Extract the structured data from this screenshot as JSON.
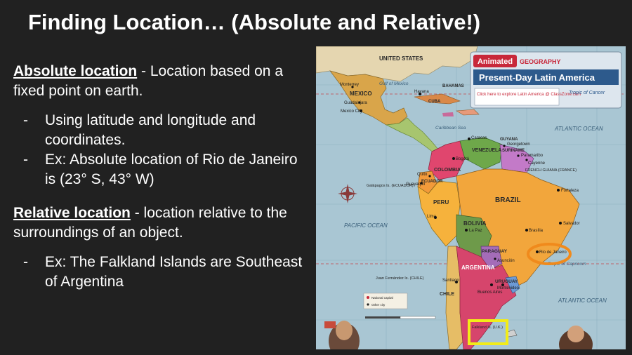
{
  "slide": {
    "title": "Finding Location… (Absolute and Relative!)"
  },
  "absolute": {
    "term": "Absolute location",
    "definition": " - Location based on a fixed point on earth.",
    "bullets": [
      "Using latitude and longitude and coordinates.",
      "Ex: Absolute location of Rio de Janeiro is (23° S, 43° W)"
    ]
  },
  "relative": {
    "term": "Relative location",
    "definition": " - location relative to the surroundings of an object.",
    "bullets": [
      "Ex: The Falkland Islands are Southeast of Argentina"
    ]
  },
  "map": {
    "brand": "Animated",
    "brand_sub": "GEOGRAPHY",
    "heading": "Present-Day Latin America",
    "click_text": "Click here to explore Latin America @ ClassZone.com",
    "tropic_cancer": "Tropic of Cancer",
    "tropic_capricorn": "Tropic of Capricorn",
    "countries": [
      "UNITED STATES",
      "MEXICO",
      "BRAZIL",
      "PERU",
      "BOLIVIA",
      "ARGENTINA",
      "CHILE",
      "COLOMBIA",
      "VENEZUELA",
      "PARAGUAY",
      "URUGUAY",
      "ECUADOR",
      "GUYANA",
      "SURINAME",
      "CUBA"
    ],
    "cities": [
      "Rio de Janeiro",
      "Brasília",
      "Lima",
      "Caracas",
      "Bogotá",
      "Santiago",
      "Buenos Aires",
      "Montevideo",
      "La Paz",
      "Mexico City",
      "Havana",
      "Salvador",
      "Fortaleza",
      "Georgetown",
      "Paramaribo",
      "Cayenne",
      "Quito",
      "Guayaquil",
      "Asunción",
      "Guadalajara",
      "Monterrey"
    ],
    "oceans": [
      "ATLANTIC OCEAN",
      "PACIFIC OCEAN",
      "ATLANTIC OCEAN"
    ],
    "gulf": "Gulf of Mexico",
    "caribbean": "Caribbean Sea",
    "french_guiana": "FRENCH GUIANA (FRANCE)",
    "galapagos": "Galápagos Is. (ECUADOR)",
    "juan_fernandez": "Juan Fernández Is. (CHILE)",
    "falkland": "Falkland Is. (U.K.)",
    "legend": [
      "National capital",
      "Other city"
    ],
    "bahamas": "BAHAMAS",
    "highlight_colors": {
      "orange": "#f08a1c",
      "yellow": "#f2ec18"
    }
  }
}
